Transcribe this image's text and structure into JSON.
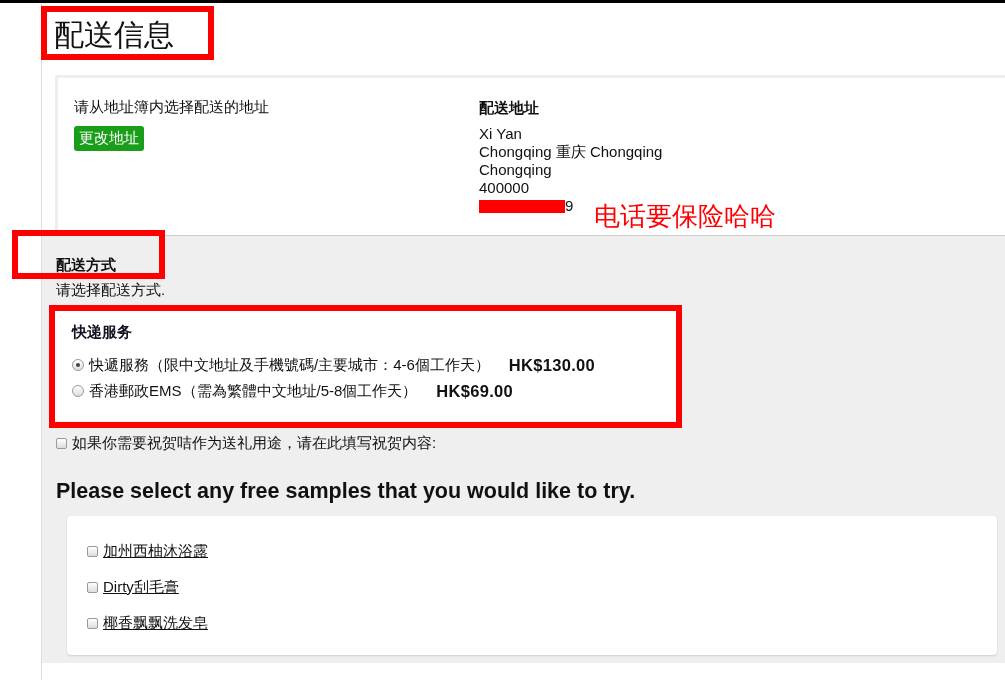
{
  "page_title": {
    "text": "配送信息",
    "annotated": true
  },
  "address_book": {
    "prompt": "请从地址簿内选择配送的地址",
    "change_button": "更改地址"
  },
  "shipping_address": {
    "heading": "配送地址",
    "lines": [
      "Xi Yan",
      "Chongqing 重庆 Chongqing",
      "Chongqing",
      "400000"
    ],
    "phone": {
      "redacted": true,
      "visible_text": "9"
    },
    "note": "电话要保险哈哈"
  },
  "shipping_method": {
    "heading": "配送方式",
    "heading_annotated": true,
    "prompt": "请选择配送方式.",
    "group_title": "快递服务",
    "options_annotated": true,
    "options": [
      {
        "label": "快遞服務（限中文地址及手機號碼/主要城市：4-6個工作天）",
        "price": "HK$130.00",
        "selected": true
      },
      {
        "label": "香港郵政EMS（需為繁體中文地址/5-8個工作天）",
        "price": "HK$69.00",
        "selected": false
      }
    ]
  },
  "gift_message": {
    "label": "如果你需要祝贺咭作为送礼用途，请在此填写祝贺内容:",
    "checked": false
  },
  "samples": {
    "heading": "Please select any free samples that you would like to try.",
    "items": [
      {
        "label": "加州西柚沐浴露",
        "checked": false
      },
      {
        "label": "Dirty刮毛膏",
        "checked": false
      },
      {
        "label": "椰香飘飘洗发皂",
        "checked": false
      }
    ]
  }
}
